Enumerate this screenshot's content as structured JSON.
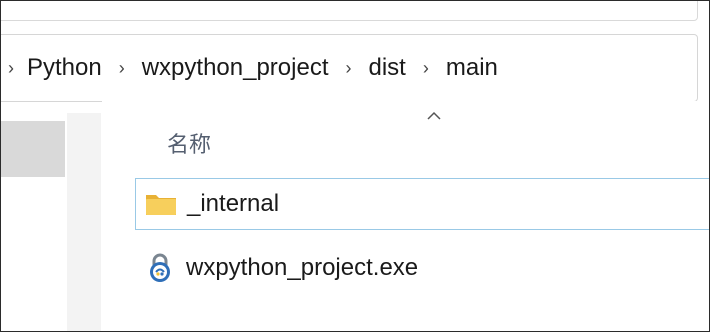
{
  "breadcrumb": {
    "items": [
      "Python",
      "wxpython_project",
      "dist",
      "main"
    ]
  },
  "file_list": {
    "column_header": "名称",
    "files": [
      {
        "name": "_internal",
        "icon": "folder-icon"
      },
      {
        "name": "wxpython_project.exe",
        "icon": "python-exe-icon"
      }
    ]
  },
  "colors": {
    "selection_border": "#99c9e6",
    "nav_selected": "#d9d9d9",
    "folder": "#f5c84c"
  }
}
